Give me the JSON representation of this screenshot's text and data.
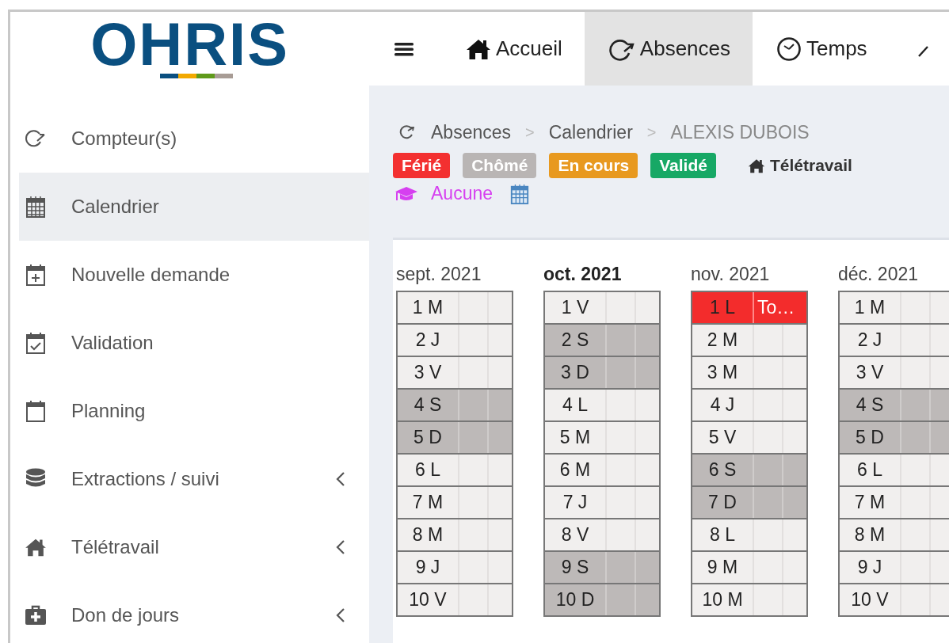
{
  "logo": "OHRIS",
  "nav": [
    {
      "label": "Accueil",
      "selected": false
    },
    {
      "label": "Absences",
      "selected": true
    },
    {
      "label": "Temps",
      "selected": false
    }
  ],
  "sidebar": {
    "items": [
      {
        "label": "Compteur(s)",
        "selected": false,
        "submenu": false
      },
      {
        "label": "Calendrier",
        "selected": true,
        "submenu": false
      },
      {
        "label": "Nouvelle demande",
        "selected": false,
        "submenu": false
      },
      {
        "label": "Validation",
        "selected": false,
        "submenu": false
      },
      {
        "label": "Planning",
        "selected": false,
        "submenu": false
      },
      {
        "label": "Extractions / suivi",
        "selected": false,
        "submenu": true
      },
      {
        "label": "Télétravail",
        "selected": false,
        "submenu": true
      },
      {
        "label": "Don de jours",
        "selected": false,
        "submenu": true
      }
    ]
  },
  "breadcrumb": [
    "Absences",
    ">",
    "Calendrier",
    ">",
    "ALEXIS DUBOIS"
  ],
  "legend": {
    "tags": [
      {
        "label": "Férié",
        "color": "#f33030"
      },
      {
        "label": "Chômé",
        "color": "#b9b5b4"
      },
      {
        "label": "En cours",
        "color": "#e8991f"
      },
      {
        "label": "Validé",
        "color": "#17a865"
      }
    ],
    "remote_label": "Télétravail",
    "training_label": "Aucune"
  },
  "months": [
    {
      "label": "sept. 2021",
      "current": false,
      "days": [
        {
          "label": "1 M",
          "kind": "workday"
        },
        {
          "label": "2 J",
          "kind": "workday"
        },
        {
          "label": "3 V",
          "kind": "workday"
        },
        {
          "label": "4 S",
          "kind": "weekend"
        },
        {
          "label": "5 D",
          "kind": "weekend"
        },
        {
          "label": "6 L",
          "kind": "workday"
        },
        {
          "label": "7 M",
          "kind": "workday"
        },
        {
          "label": "8 M",
          "kind": "workday"
        },
        {
          "label": "9 J",
          "kind": "workday"
        },
        {
          "label": "10 V",
          "kind": "workday"
        }
      ]
    },
    {
      "label": "oct. 2021",
      "current": true,
      "days": [
        {
          "label": "1 V",
          "kind": "workday"
        },
        {
          "label": "2 S",
          "kind": "weekend"
        },
        {
          "label": "3 D",
          "kind": "weekend"
        },
        {
          "label": "4 L",
          "kind": "workday"
        },
        {
          "label": "5 M",
          "kind": "workday"
        },
        {
          "label": "6 M",
          "kind": "workday"
        },
        {
          "label": "7 J",
          "kind": "workday"
        },
        {
          "label": "8 V",
          "kind": "workday"
        },
        {
          "label": "9 S",
          "kind": "weekend"
        },
        {
          "label": "10 D",
          "kind": "weekend"
        }
      ]
    },
    {
      "label": "nov. 2021",
      "current": false,
      "days": [
        {
          "label": "1 L",
          "kind": "holiday",
          "note": "To…"
        },
        {
          "label": "2 M",
          "kind": "workday"
        },
        {
          "label": "3 M",
          "kind": "workday"
        },
        {
          "label": "4 J",
          "kind": "workday"
        },
        {
          "label": "5 V",
          "kind": "workday"
        },
        {
          "label": "6 S",
          "kind": "weekend"
        },
        {
          "label": "7 D",
          "kind": "weekend"
        },
        {
          "label": "8 L",
          "kind": "workday"
        },
        {
          "label": "9 M",
          "kind": "workday"
        },
        {
          "label": "10 M",
          "kind": "workday"
        }
      ]
    },
    {
      "label": "déc. 2021",
      "current": false,
      "days": [
        {
          "label": "1 M",
          "kind": "workday"
        },
        {
          "label": "2 J",
          "kind": "workday"
        },
        {
          "label": "3 V",
          "kind": "workday"
        },
        {
          "label": "4 S",
          "kind": "weekend"
        },
        {
          "label": "5 D",
          "kind": "weekend"
        },
        {
          "label": "6 L",
          "kind": "workday"
        },
        {
          "label": "7 M",
          "kind": "workday"
        },
        {
          "label": "8 M",
          "kind": "workday"
        },
        {
          "label": "9 J",
          "kind": "workday"
        },
        {
          "label": "10 V",
          "kind": "workday"
        }
      ]
    }
  ]
}
